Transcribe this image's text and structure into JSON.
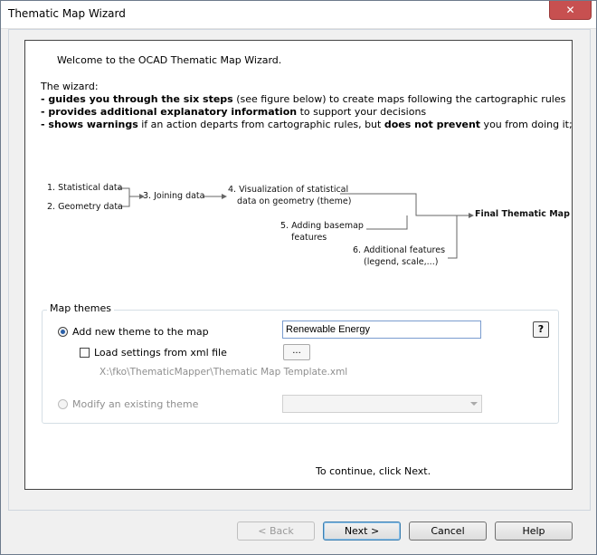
{
  "window": {
    "title": "Thematic Map Wizard",
    "close_glyph": "✕"
  },
  "intro": {
    "welcome": "Welcome to the OCAD Thematic Map Wizard.",
    "heading": "The wizard:",
    "line1_bold": "guides you through the six steps",
    "line1_rest": " (see figure below) to create maps following the cartographic rules",
    "line2_bold": "provides additional explanatory information",
    "line2_rest": " to support your decisions",
    "line3_bold": "shows warnings",
    "line3_mid": " if an action departs from cartographic rules, but ",
    "line3_bold2": "does not prevent",
    "line3_rest": " you from doing it;",
    "bullet": "- "
  },
  "diagram": {
    "step1": "1.  Statistical data",
    "step2": "2.  Geometry data",
    "step3": "3.  Joining data",
    "step4_line1": "4.  Visualization of statistical",
    "step4_line2": "data on geometry (theme)",
    "step5_line1": "5.  Adding basemap",
    "step5_line2": "features",
    "step6_line1": "6.  Additional features",
    "step6_line2": "(legend, scale,...)",
    "final": "Final Thematic Map"
  },
  "map_themes": {
    "group_title": "Map themes",
    "add_new_label": "Add new theme to the map",
    "theme_name_value": "Renewable Energy",
    "load_settings_label": "Load settings from xml file",
    "browse_label": "...",
    "xml_path": "X:\\fko\\ThematicMapper\\Thematic Map Template.xml",
    "modify_label": "Modify an existing theme",
    "help_label": "?"
  },
  "footer": {
    "continue_text": "To continue, click Next."
  },
  "buttons": {
    "back": "< Back",
    "next": "Next >",
    "cancel": "Cancel",
    "help": "Help"
  }
}
